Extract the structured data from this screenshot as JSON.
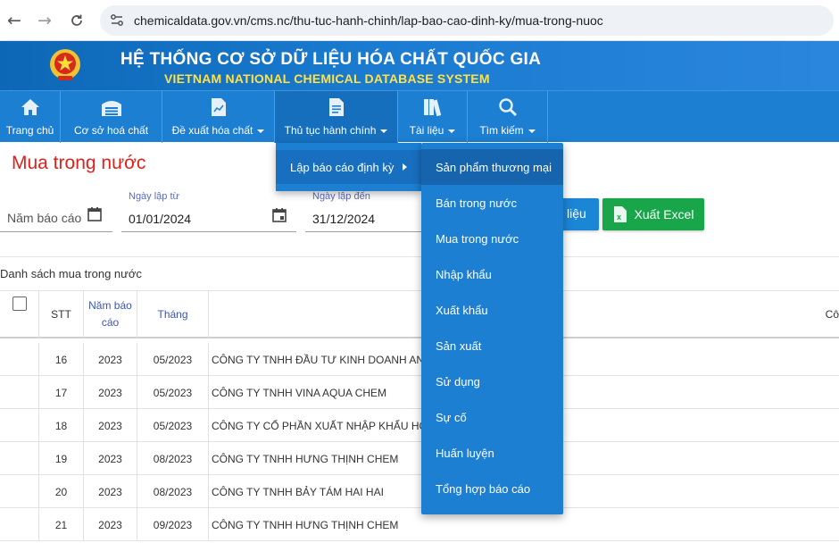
{
  "browser": {
    "url": "chemicaldata.gov.vn/cms.nc/thu-tuc-hanh-chinh/lap-bao-cao-dinh-ky/mua-trong-nuoc"
  },
  "header": {
    "title_vn": "HỆ THỐNG CƠ SỞ DỮ LIỆU HÓA CHẤT QUỐC GIA",
    "title_en": "VIETNAM NATIONAL CHEMICAL DATABASE SYSTEM"
  },
  "nav": {
    "items": [
      {
        "label": "Trang chủ",
        "icon": "home-icon"
      },
      {
        "label": "Cơ sở hoá chất",
        "icon": "warehouse-icon"
      },
      {
        "label": "Đề xuất hóa chất",
        "icon": "chart-document-icon"
      },
      {
        "label": "Thủ tục hành chính",
        "icon": "document-icon"
      },
      {
        "label": "Tài liệu",
        "icon": "books-icon"
      },
      {
        "label": "Tìm kiếm",
        "icon": "search-icon"
      }
    ]
  },
  "dropdown": {
    "level1": {
      "label": "Lập báo cáo định kỳ"
    },
    "level2": [
      "Sản phẩm thương mại",
      "Bán trong nước",
      "Mua trong nước",
      "Nhập khẩu",
      "Xuất khẩu",
      "Sản xuất",
      "Sử dụng",
      "Sự cố",
      "Huấn luyện",
      "Tổng hợp báo cáo"
    ]
  },
  "page": {
    "title": "Mua trong nước"
  },
  "filters": {
    "year_placeholder": "Năm báo cáo",
    "date_from_label": "Ngày lập từ",
    "date_from_value": "01/01/2024",
    "date_to_label": "Ngày lập đến",
    "date_to_value": "31/12/2024",
    "data_button_label": "liệu",
    "excel_button_label": "Xuất Excel"
  },
  "list": {
    "caption": "Danh sách mua trong nước",
    "columns": {
      "stt": "STT",
      "year_line1": "Năm báo",
      "year_line2": "cáo",
      "month": "Tháng",
      "company_partial": "Cô"
    },
    "rows": [
      {
        "stt": "16",
        "year": "2023",
        "month": "05/2023",
        "company": "CÔNG TY TNHH ĐẦU TƯ KINH DOANH AN LỘC"
      },
      {
        "stt": "17",
        "year": "2023",
        "month": "05/2023",
        "company": "CÔNG TY TNHH VINA AQUA CHEM"
      },
      {
        "stt": "18",
        "year": "2023",
        "month": "05/2023",
        "company": "CÔNG TY CỔ PHẦN XUẤT NHẬP KHẨU HÓA C"
      },
      {
        "stt": "19",
        "year": "2023",
        "month": "08/2023",
        "company": "CÔNG TY TNHH HƯNG THỊNH CHEM"
      },
      {
        "stt": "20",
        "year": "2023",
        "month": "08/2023",
        "company": "CÔNG TY TNHH BẢY TÁM HAI HAI"
      },
      {
        "stt": "21",
        "year": "2023",
        "month": "09/2023",
        "company": "CÔNG TY TNHH HƯNG THỊNH CHEM"
      }
    ]
  },
  "colors": {
    "nav_blue": "#1c7fd2",
    "title_red": "#e0201b",
    "excel_green": "#19a64a",
    "header_yellow": "#ffe14a"
  }
}
